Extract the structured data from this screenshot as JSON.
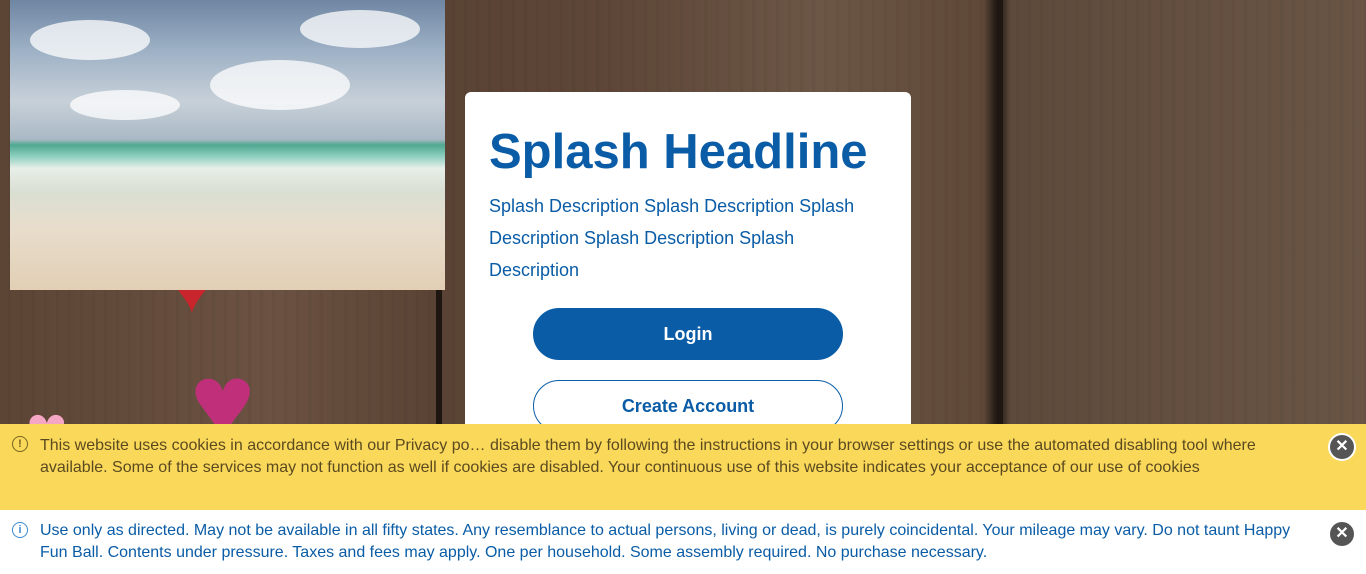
{
  "splash": {
    "headline": "Splash Headline",
    "description": "Splash Description Splash Description Splash Description Splash Description Splash Description",
    "login_label": "Login",
    "create_account_label": "Create Account"
  },
  "cookie_banner": {
    "text": "This website uses cookies in accordance with our Privacy po… disable them by following the instructions in your browser settings or use the automated disabling tool where available. Some of the services may not function as well if cookies are disabled. Your continuous use of this website indicates your acceptance of our use of cookies",
    "close_label": "✕"
  },
  "notice_banner": {
    "text": "Use only as directed. May not be available in all fifty states. Any resemblance to actual persons, living or dead, is purely coincidental. Your mileage may vary. Do not taunt Happy Fun Ball. Contents under pressure. Taxes and fees may apply. One per household. Some assembly required. No purchase necessary.",
    "close_label": "✕"
  },
  "colors": {
    "brand_blue": "#0a5ca6",
    "cookie_yellow": "#fad85a"
  }
}
